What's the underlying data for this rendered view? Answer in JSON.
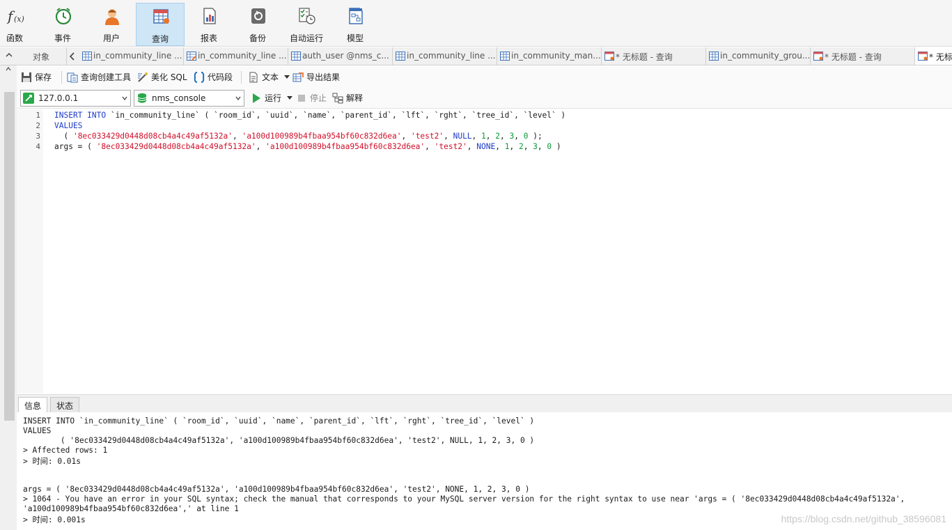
{
  "toolbar": {
    "items": [
      {
        "label": "函数",
        "icon": "function-icon"
      },
      {
        "label": "事件",
        "icon": "alarm-clock-icon"
      },
      {
        "label": "用户",
        "icon": "user-icon"
      },
      {
        "label": "查询",
        "icon": "query-table-icon",
        "active": true
      },
      {
        "label": "报表",
        "icon": "report-icon"
      },
      {
        "label": "备份",
        "icon": "backup-icon"
      },
      {
        "label": "自动运行",
        "icon": "automation-icon"
      },
      {
        "label": "模型",
        "icon": "model-icon"
      }
    ]
  },
  "tabs": {
    "objects_label": "对象",
    "items": [
      {
        "label": "in_community_line ...",
        "icon": "table-icon"
      },
      {
        "label": "in_community_line ...",
        "icon": "table-edit-icon"
      },
      {
        "label": "auth_user @nms_c...",
        "icon": "table-icon"
      },
      {
        "label": "in_community_line ...",
        "icon": "table-icon"
      },
      {
        "label": "in_community_man...",
        "icon": "table-icon"
      },
      {
        "label": "* 无标题 - 查询",
        "icon": "query-icon"
      },
      {
        "label": "in_community_grou...",
        "icon": "table-icon"
      },
      {
        "label": "* 无标题 - 查询",
        "icon": "query-icon"
      },
      {
        "label": "* 无标",
        "icon": "query-icon",
        "active": true
      }
    ]
  },
  "query_toolbar": {
    "save": "保存",
    "query_builder": "查询创建工具",
    "beautify_sql": "美化 SQL",
    "code_snippet": "代码段",
    "text": "文本",
    "export_results": "导出结果"
  },
  "connection": {
    "host": "127.0.0.1",
    "database": "nms_console",
    "run": "运行",
    "stop": "停止",
    "explain": "解释"
  },
  "editor": {
    "line_numbers": [
      "1",
      "2",
      "3",
      "4"
    ]
  },
  "result_tabs": {
    "info": "信息",
    "status": "状态"
  },
  "output": {
    "lines": [
      "INSERT INTO `in_community_line` ( `room_id`, `uuid`, `name`, `parent_id`, `lft`, `rght`, `tree_id`, `level` )",
      "VALUES",
      "        ( '8ec033429d0448d08cb4a4c49af5132a', 'a100d100989b4fbaa954bf60c832d6ea', 'test2', NULL, 1, 2, 3, 0 )",
      "> Affected rows: 1",
      "> 时间: 0.01s",
      "args = ( '8ec033429d0448d08cb4a4c49af5132a', 'a100d100989b4fbaa954bf60c832d6ea', 'test2', NONE, 1, 2, 3, 0 )",
      "> 1064 - You have an error in your SQL syntax; check the manual that corresponds to your MySQL server version for the right syntax to use near 'args = ( '8ec033429d0448d08cb4a4c49af5132a',",
      "'a100d100989b4fbaa954bf60c832d6ea',' at line 1",
      "> 时间: 0.001s"
    ]
  },
  "watermark": "https://blog.csdn.net/github_38596081",
  "colors": {
    "keyword": "#1e3cc8",
    "string": "#d0102a",
    "number": "#0a9a3a",
    "active_tab": "#cfe6f7"
  }
}
